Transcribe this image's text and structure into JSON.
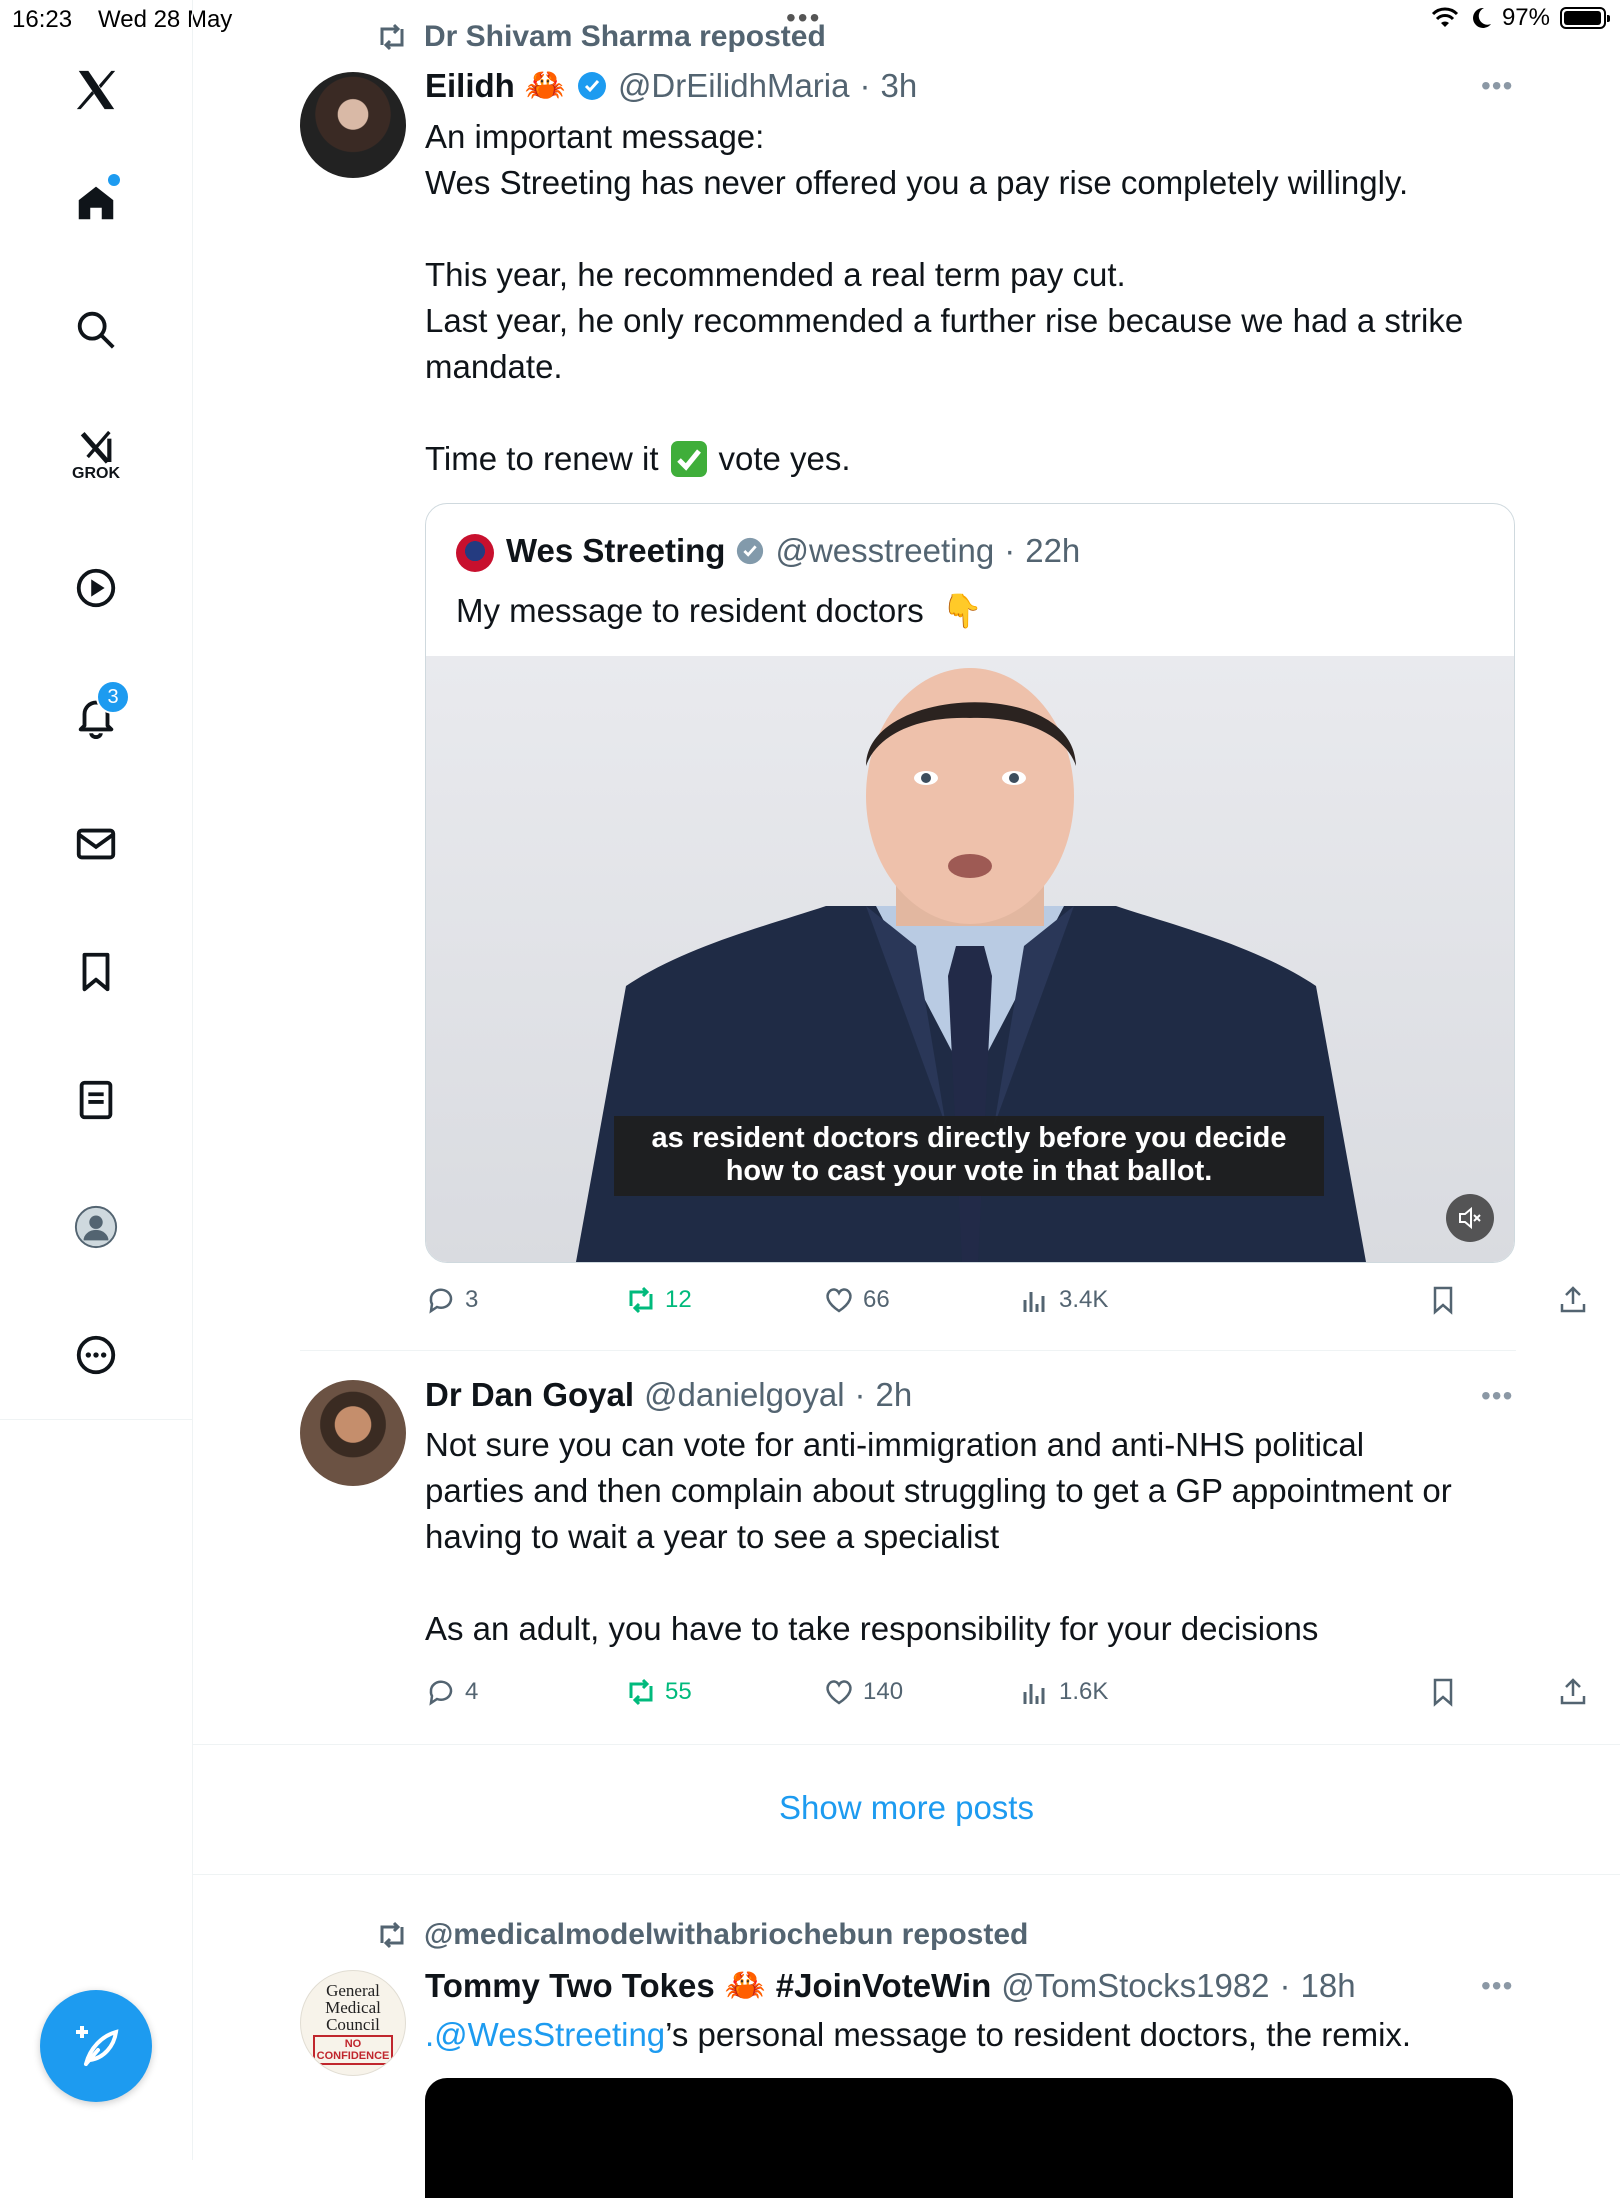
{
  "status_bar": {
    "time": "16:23",
    "date": "Wed 28 May",
    "battery": "97%",
    "battery_level": 0.97
  },
  "sidebar": {
    "notifications_badge": "3",
    "grok_label": "GROK"
  },
  "posts": [
    {
      "repost_by": "Dr Shivam Sharma reposted",
      "author_name": "Eilidh",
      "author_emoji": "🦀",
      "handle": "@DrEilidhMaria",
      "time": "3h",
      "lines": [
        "An important message:",
        "Wes Streeting has never offered you a pay rise completely willingly.",
        "",
        "This year, he recommended a real term pay cut.",
        "Last year, he only recommended a further rise because we had a strike",
        "mandate.",
        "",
        "Time to renew it",
        "vote yes."
      ],
      "quote": {
        "author_name": "Wes Streeting",
        "handle": "@wesstreeting",
        "time": "22h",
        "text": "My message to resident doctors",
        "emoji": "👇",
        "subtitle_line1": "as resident doctors directly before you decide",
        "subtitle_line2": "how to cast your vote in that ballot."
      },
      "stats": {
        "replies": "3",
        "reposts": "12",
        "likes": "66",
        "views": "3.4K"
      }
    },
    {
      "author_name": "Dr Dan Goyal",
      "handle": "@danielgoyal",
      "time": "2h",
      "lines": [
        "Not sure you can vote for anti-immigration and anti-NHS political",
        "parties and then complain about struggling to get a GP appointment or",
        "having to wait a year to see a specialist",
        "",
        "As an adult, you have to take responsibility for your decisions"
      ],
      "stats": {
        "replies": "4",
        "reposts": "55",
        "likes": "140",
        "views": "1.6K"
      }
    }
  ],
  "show_more": "Show more posts",
  "post3": {
    "repost_by": "@medicalmodelwithabriochebun reposted",
    "author_name": "Tommy Two Tokes",
    "author_emoji": "🦀",
    "hashtag": "#JoinVoteWin",
    "handle": "@TomStocks1982",
    "time": "18h",
    "mention": ".@WesStreeting",
    "text_rest": "’s personal message to resident doctors, the remix.",
    "avatar_lines": [
      "General",
      "Medical",
      "Council",
      "NO",
      "CONFIDENCE"
    ]
  },
  "colors": {
    "accent": "#1d9bf0",
    "repost_green": "#00ba7c",
    "muted": "#536471"
  }
}
